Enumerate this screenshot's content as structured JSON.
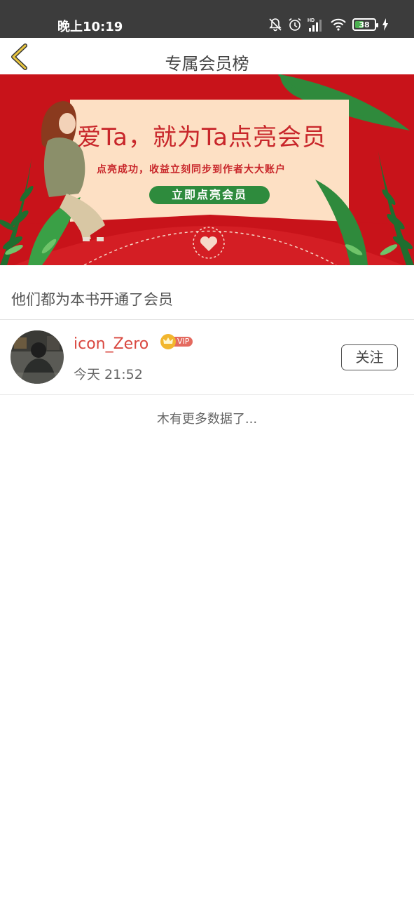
{
  "status_bar": {
    "time": "晚上10:19",
    "battery_level": "38",
    "icons": [
      "bell-muted-icon",
      "alarm-icon",
      "hd-signal-icon",
      "wifi-icon",
      "battery-icon",
      "charging-icon"
    ]
  },
  "nav": {
    "back_icon": "chevron-left-icon",
    "title": "专属会员榜"
  },
  "banner": {
    "headline": "爱Ta，就为Ta点亮会员",
    "subtitle": "点亮成功，收益立刻同步到作者大大账户",
    "cta": "立即点亮会员",
    "colors": {
      "background": "#c8131a",
      "card": "#fde0c4",
      "accent": "#c8262a",
      "button": "#2e8b3d"
    }
  },
  "section": {
    "title": "他们都为本书开通了会员"
  },
  "members": [
    {
      "username": "icon_Zero",
      "vip_label": "VIP",
      "time": "今天 21:52",
      "follow_label": "关注"
    }
  ],
  "footer": {
    "no_more": "木有更多数据了..."
  },
  "colors": {
    "username": "#d9473f",
    "status_bar": "#3c3c3c",
    "back_icon": "#e8c540"
  }
}
